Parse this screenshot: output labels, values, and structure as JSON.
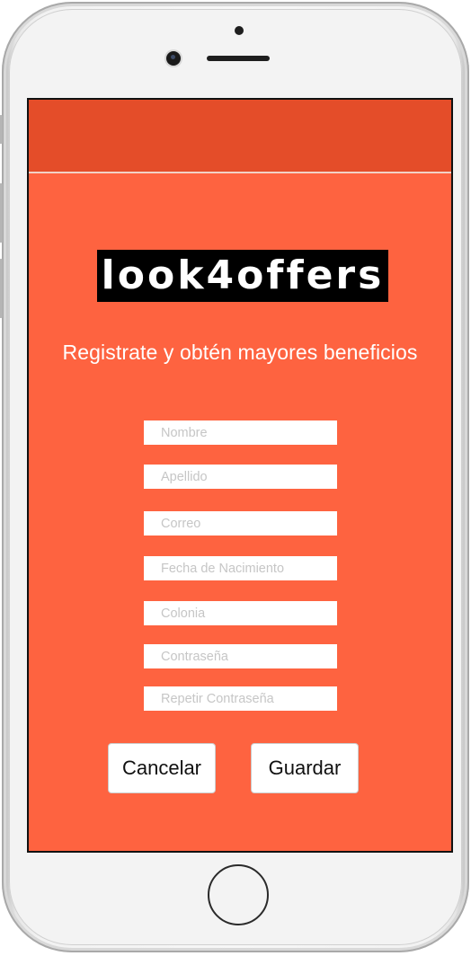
{
  "logo": {
    "text": "look4offers"
  },
  "headline": "Registrate y obtén mayores beneficios",
  "form": {
    "nombre_placeholder": "Nombre",
    "apellido_placeholder": "Apellido",
    "correo_placeholder": "Correo",
    "fecha_placeholder": "Fecha de Nacimiento",
    "colonia_placeholder": "Colonia",
    "contrasena_placeholder": "Contraseña",
    "repetir_placeholder": "Repetir Contraseña"
  },
  "buttons": {
    "cancel_label": "Cancelar",
    "save_label": "Guardar"
  },
  "colors": {
    "background": "#fe6340",
    "app_bar": "#e44d29",
    "logo_bg": "#000000"
  }
}
